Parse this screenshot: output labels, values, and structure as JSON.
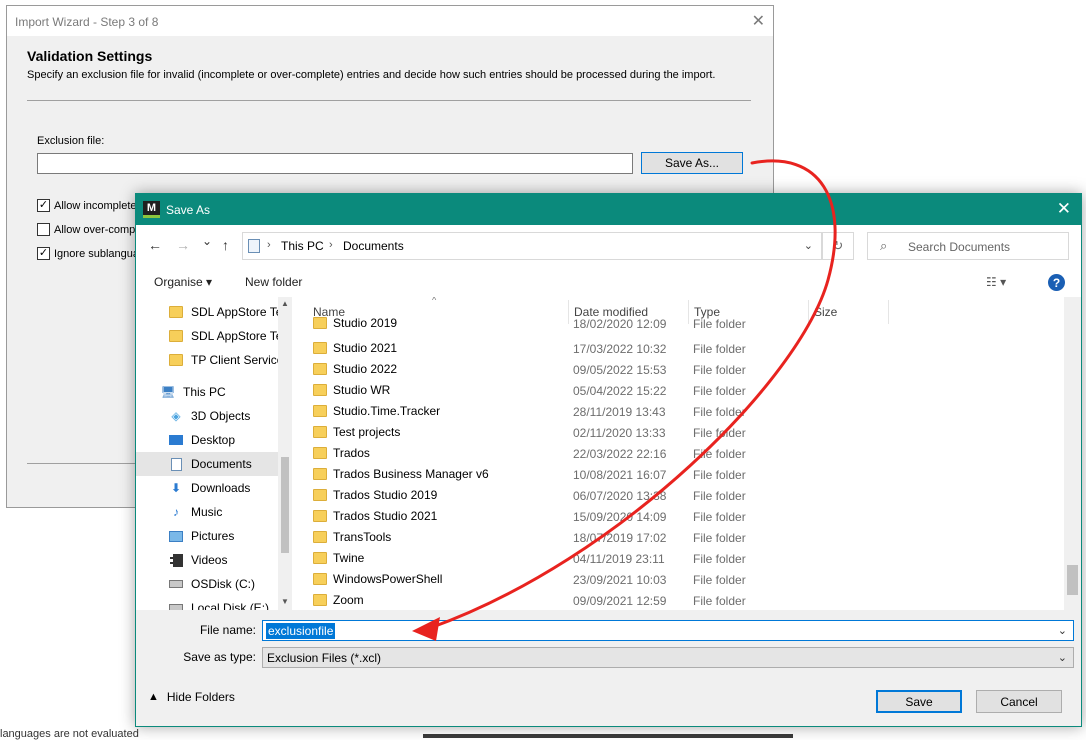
{
  "wizard": {
    "title": "Import Wizard - Step 3 of 8",
    "close_glyph": "✕",
    "heading": "Validation Settings",
    "description": "Specify an exclusion file for invalid (incomplete or over-complete) entries and decide how such entries should be processed during the import.",
    "exclusion_label": "Exclusion file:",
    "exclusion_value": "",
    "save_as_label": "Save As...",
    "checkboxes": [
      {
        "label": "Allow incomplete e",
        "checked": true
      },
      {
        "label": "Allow over-comple",
        "checked": false
      },
      {
        "label": "Ignore sublangua",
        "checked": true
      }
    ],
    "bottom_text": "languages are not evaluated"
  },
  "dialog": {
    "title": "Save As",
    "app_icon_letter": "M",
    "close_glyph": "✕",
    "nav": {
      "back": "←",
      "forward": "→",
      "recent": "⌄",
      "up": "↑"
    },
    "breadcrumb": [
      "This PC",
      "Documents"
    ],
    "breadcrumb_sep": "›",
    "refresh_glyph": "↻",
    "search_placeholder": "Search Documents",
    "toolbar": {
      "organise": "Organise ▾",
      "new_folder": "New folder",
      "view_glyph": "☷ ▾",
      "help": "?"
    },
    "sidebar": [
      {
        "label": "SDL AppStore Te",
        "icon": "folder-icon"
      },
      {
        "label": "SDL AppStore Te",
        "icon": "folder-icon"
      },
      {
        "label": "TP Client Service",
        "icon": "folder-icon"
      },
      {
        "label": "This PC",
        "icon": "pc-icon"
      },
      {
        "label": "3D Objects",
        "icon": "cube-icon"
      },
      {
        "label": "Desktop",
        "icon": "desktop-icon"
      },
      {
        "label": "Documents",
        "icon": "documents-icon",
        "selected": true
      },
      {
        "label": "Downloads",
        "icon": "download-icon"
      },
      {
        "label": "Music",
        "icon": "music-icon"
      },
      {
        "label": "Pictures",
        "icon": "pictures-icon"
      },
      {
        "label": "Videos",
        "icon": "video-icon"
      },
      {
        "label": "OSDisk (C:)",
        "icon": "disk-icon"
      },
      {
        "label": "Local Disk (E:)",
        "icon": "disk-icon"
      }
    ],
    "columns": {
      "name": "Name",
      "date": "Date modified",
      "type": "Type",
      "size": "Size"
    },
    "files": [
      {
        "name": "Studio 2019",
        "date": "18/02/2020 12:09",
        "type": "File folder"
      },
      {
        "name": "Studio 2021",
        "date": "17/03/2022 10:32",
        "type": "File folder"
      },
      {
        "name": "Studio 2022",
        "date": "09/05/2022 15:53",
        "type": "File folder"
      },
      {
        "name": "Studio WR",
        "date": "05/04/2022 15:22",
        "type": "File folder"
      },
      {
        "name": "Studio.Time.Tracker",
        "date": "28/11/2019 13:43",
        "type": "File folder"
      },
      {
        "name": "Test projects",
        "date": "02/11/2020 13:33",
        "type": "File folder"
      },
      {
        "name": "Trados",
        "date": "22/03/2022 22:16",
        "type": "File folder"
      },
      {
        "name": "Trados Business Manager v6",
        "date": "10/08/2021 16:07",
        "type": "File folder"
      },
      {
        "name": "Trados Studio 2019",
        "date": "06/07/2020 13:38",
        "type": "File folder"
      },
      {
        "name": "Trados Studio 2021",
        "date": "15/09/2020 14:09",
        "type": "File folder"
      },
      {
        "name": "TransTools",
        "date": "18/07/2019 17:02",
        "type": "File folder"
      },
      {
        "name": "Twine",
        "date": "04/11/2019 23:11",
        "type": "File folder"
      },
      {
        "name": "WindowsPowerShell",
        "date": "23/09/2021 10:03",
        "type": "File folder"
      },
      {
        "name": "Zoom",
        "date": "09/09/2021 12:59",
        "type": "File folder"
      }
    ],
    "file_name_label": "File name:",
    "file_name_value": "exclusionfile",
    "save_type_label": "Save as type:",
    "save_type_value": "Exclusion Files (*.xcl)",
    "hide_folders_label": "Hide Folders",
    "save_button": "Save",
    "cancel_button": "Cancel"
  },
  "colors": {
    "title_bar": "#0b8a7c",
    "accent": "#0078d7",
    "annotation_arrow": "#e8231f"
  }
}
